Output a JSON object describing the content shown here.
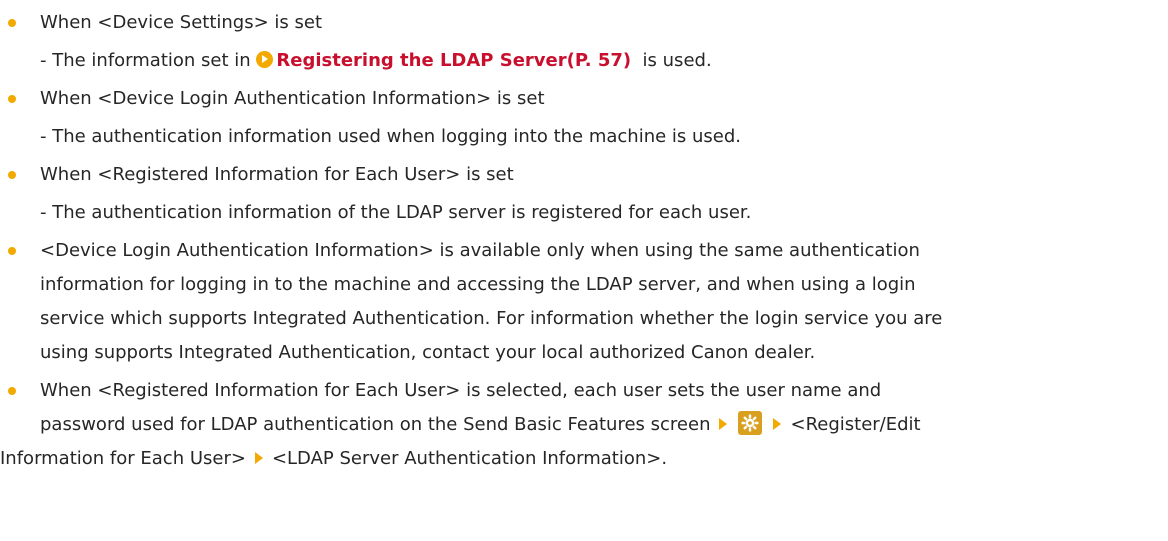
{
  "items": [
    {
      "text": "When <Device Settings> is set",
      "sub": {
        "prefix": "- The information set in ",
        "link_text": "Registering the LDAP Server(P. 57)",
        "suffix": "  is used."
      }
    },
    {
      "text": "When <Device Login Authentication Information> is set",
      "sub_text": "- The authentication information used when logging into the machine is used."
    },
    {
      "text": "When <Registered Information for Each User> is set",
      "sub_text": "- The authentication information of the LDAP server is registered for each user."
    },
    {
      "lines": [
        "<Device Login Authentication Information> is available only when using the same authentication",
        "information for logging in to the machine and accessing the LDAP server, and when using a login",
        "service which supports Integrated Authentication. For information whether the login service you are",
        "using supports Integrated Authentication, contact your local authorized Canon dealer."
      ]
    },
    {
      "line1": "When <Registered Information for Each User> is selected, each user sets the user name and",
      "line2_prefix": "password used for LDAP authentication on the Send Basic Features screen",
      "line2_suffix": "<Register/Edit",
      "line3_prefix": "Information for Each User>",
      "line3_suffix": "<LDAP Server Authentication Information>."
    }
  ],
  "icons": {
    "link_icon": "link-arrow-icon",
    "menu_arrow": "triangle-right-icon",
    "settings": "gear-icon"
  },
  "colors": {
    "bullet": "#f2a900",
    "link": "#c8102e",
    "text": "#262626"
  }
}
